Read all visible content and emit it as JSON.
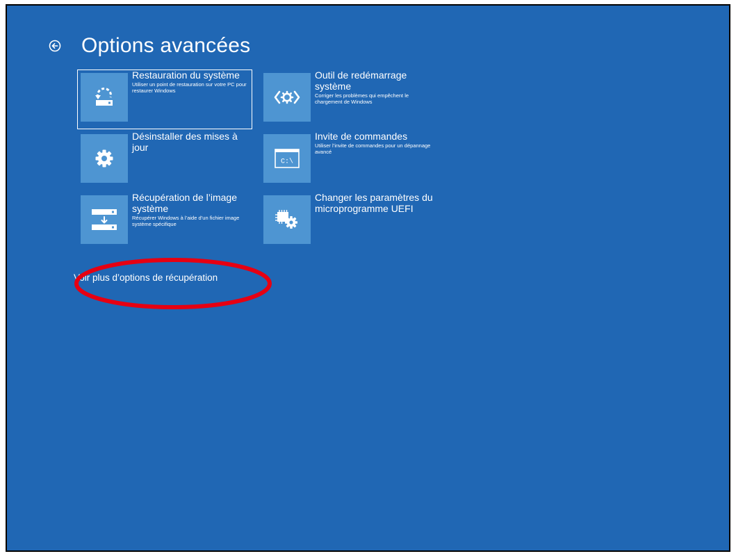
{
  "header": {
    "title": "Options avancées",
    "back_icon": "back-arrow-circle-icon"
  },
  "tiles": [
    {
      "title": "Restauration du système",
      "description": "Utiliser un point de restauration sur votre PC pour restaurer Windows",
      "icon": "system-restore-icon",
      "selected": true
    },
    {
      "title": "Outil de redémarrage système",
      "description": "Corriger les problèmes qui empêchent le chargement de Windows",
      "icon": "startup-repair-icon",
      "selected": false
    },
    {
      "title": "Désinstaller des mises à jour",
      "description": "",
      "icon": "gear-icon",
      "selected": false
    },
    {
      "title": "Invite de commandes",
      "description": "Utiliser l’invite de commandes pour un dépannage avancé",
      "icon": "command-prompt-icon",
      "selected": false
    },
    {
      "title": "Récupération de l’image système",
      "description": "Récupérer Windows à l’aide d’un fichier image système spécifique",
      "icon": "system-image-recovery-icon",
      "selected": false
    },
    {
      "title": "Changer les paramètres du microprogramme UEFI",
      "description": "",
      "icon": "uefi-firmware-settings-icon",
      "selected": false
    }
  ],
  "more_options": {
    "label": "Voir plus d’options de récupération"
  },
  "icons": {
    "cmd_glyph": "C:\\"
  },
  "colors": {
    "background": "#2067b4",
    "tile_icon_bg": "#4e95d2",
    "text": "#ffffff",
    "annotation": "#e60012"
  }
}
